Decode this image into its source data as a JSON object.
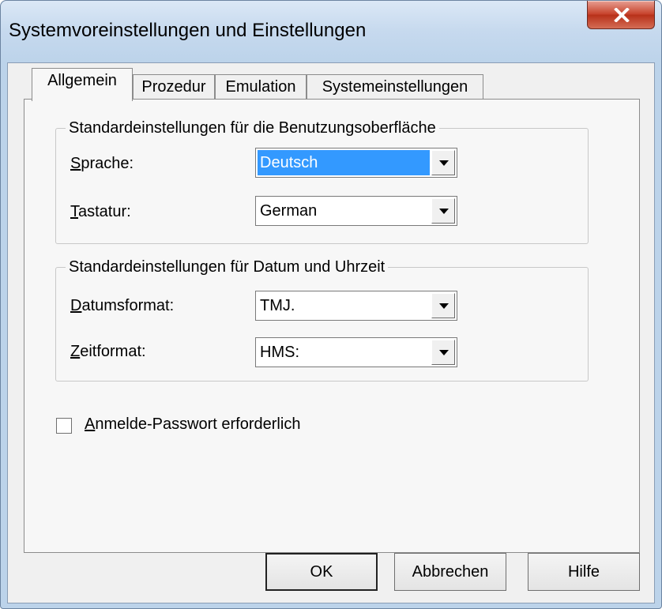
{
  "window": {
    "title": "Systemvoreinstellungen und Einstellungen"
  },
  "tabs": [
    {
      "label": "Allgemein",
      "active": true
    },
    {
      "label": "Prozedur",
      "active": false
    },
    {
      "label": "Emulation",
      "active": false
    },
    {
      "label": "Systemeinstellungen",
      "active": false
    }
  ],
  "ui_group": {
    "legend": "Standardeinstellungen für die Benutzungsoberfläche",
    "language": {
      "label_accel": "S",
      "label_rest": "prache:",
      "value": "Deutsch"
    },
    "keyboard": {
      "label_accel": "T",
      "label_rest": "astatur:",
      "value": "German"
    }
  },
  "datetime_group": {
    "legend": "Standardeinstellungen für Datum und Uhrzeit",
    "date_format": {
      "label_accel": "D",
      "label_rest": "atumsformat:",
      "value": "TMJ."
    },
    "time_format": {
      "label_accel": "Z",
      "label_rest": "eitformat:",
      "value": "HMS:"
    }
  },
  "password_checkbox": {
    "label_accel": "A",
    "label_rest": "nmelde-Passwort erforderlich",
    "checked": false
  },
  "buttons": {
    "ok": "OK",
    "cancel": "Abbrechen",
    "help": "Hilfe"
  },
  "colors": {
    "selection": "#3399ff",
    "close_button": "#c7432c",
    "frame": "#bcd3ea"
  },
  "icons": {
    "close": "close-x-icon",
    "dropdown": "chevron-down-icon"
  }
}
